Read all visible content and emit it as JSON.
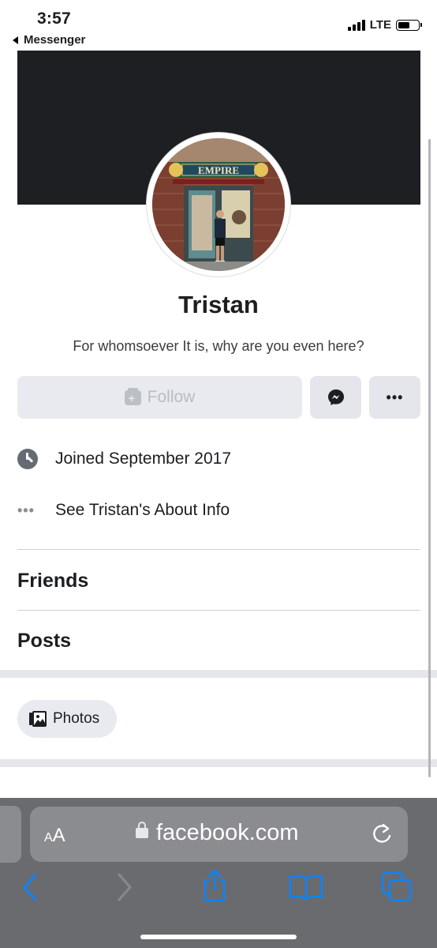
{
  "status_bar": {
    "time": "3:57",
    "back_app": "Messenger",
    "network": "LTE",
    "signal_icon": "signal-bars-icon",
    "battery_level": 0.6
  },
  "profile": {
    "name": "Tristan",
    "bio": "For whomsoever It is, why are you even here?",
    "avatar_sign": "EMPIRE",
    "follow_label": "Follow",
    "messenger_icon": "messenger-icon",
    "more_icon": "more-dots-icon"
  },
  "info": {
    "joined": "Joined September 2017",
    "about": "See Tristan's About Info"
  },
  "sections": {
    "friends": "Friends",
    "posts": "Posts",
    "photos_chip": "Photos"
  },
  "browser": {
    "aa_large": "A",
    "aa_small": "A",
    "url": "facebook.com",
    "accent": "#0a84ff"
  }
}
